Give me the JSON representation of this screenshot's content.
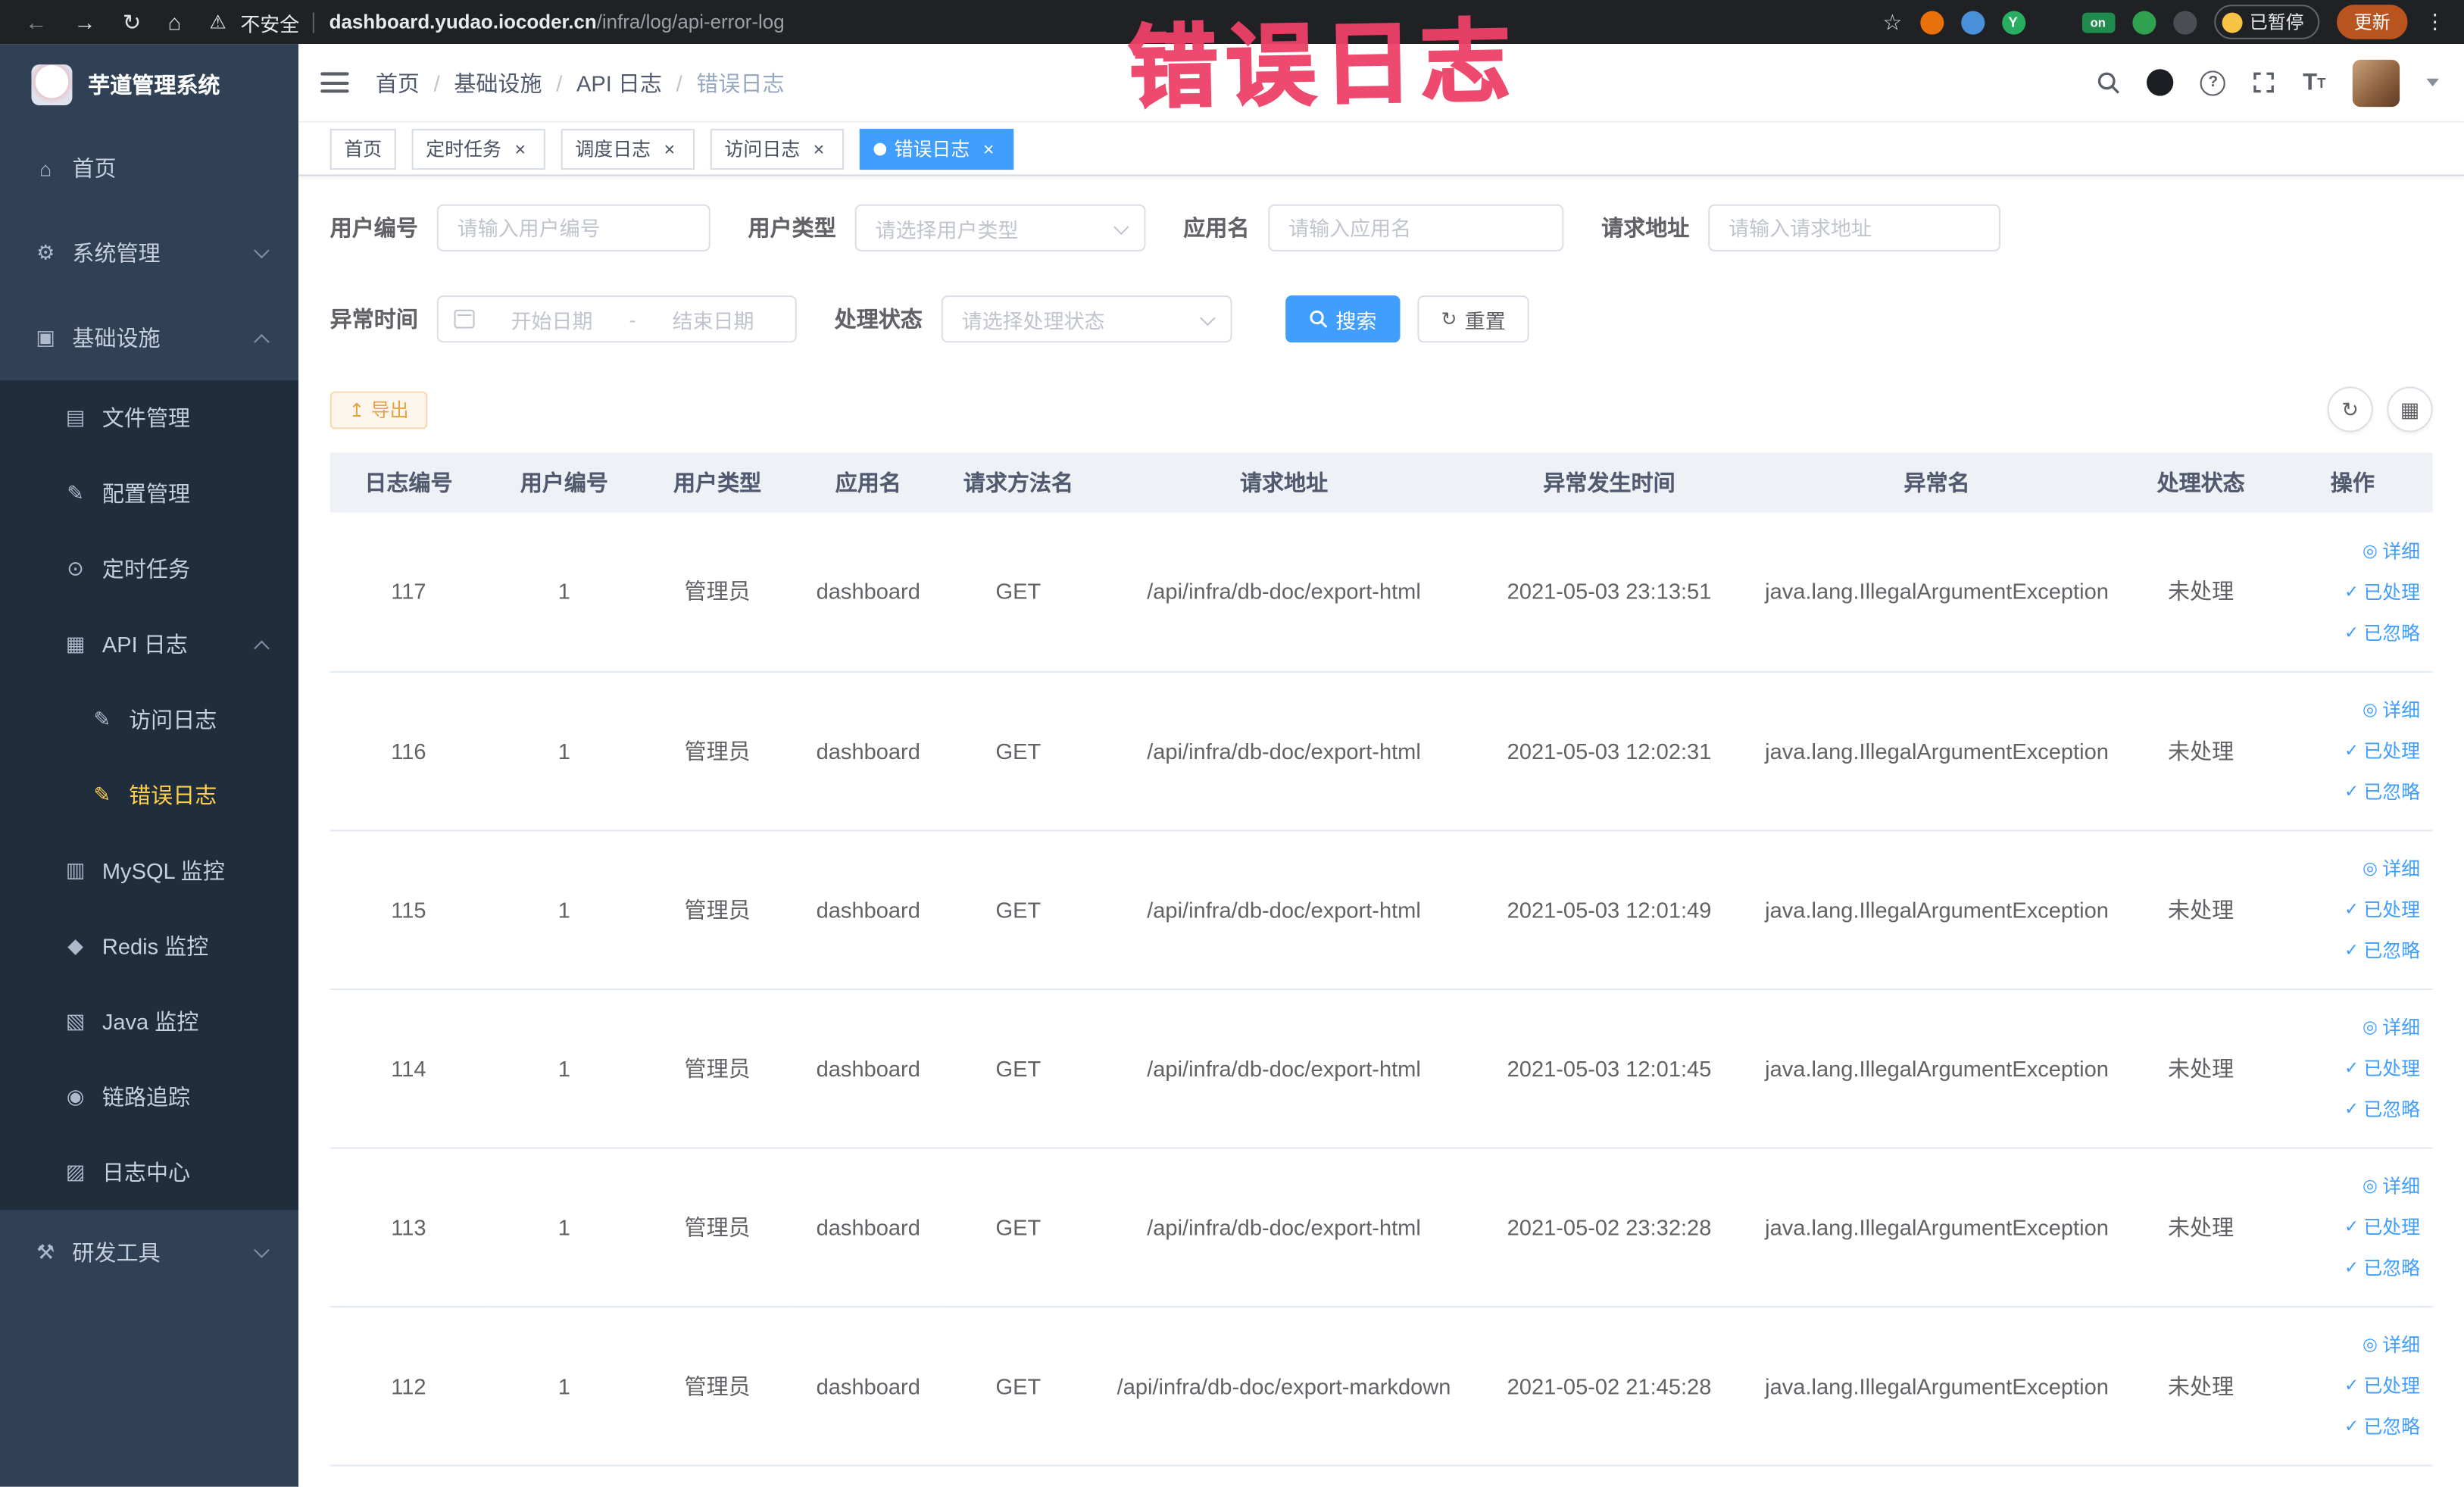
{
  "colors": {
    "accent": "#409EFF",
    "sidebar_bg": "#304156",
    "submenu_bg": "#1f2d3d",
    "active_menu_item": "#ffd04b",
    "warning": "#e6a23c",
    "annotation": "#ee4168"
  },
  "browser": {
    "security_label": "不安全",
    "url": "dashboard.yudao.iocoder.cn/infra/log/api-error-log",
    "paused_badge": "已暂停",
    "update_button": "更新"
  },
  "annotation": {
    "text": "错误日志"
  },
  "sidebar": {
    "title": "芋道管理系统",
    "items": [
      {
        "key": "home",
        "label": "首页",
        "icon": "home-icon"
      },
      {
        "key": "system",
        "label": "系统管理",
        "icon": "gear-icon",
        "group": true,
        "expanded": false
      },
      {
        "key": "infra",
        "label": "基础设施",
        "icon": "infra-icon",
        "group": true,
        "expanded": true,
        "children": [
          {
            "key": "file",
            "label": "文件管理",
            "icon": "file-icon"
          },
          {
            "key": "config",
            "label": "配置管理",
            "icon": "config-icon"
          },
          {
            "key": "job",
            "label": "定时任务",
            "icon": "timer-icon"
          },
          {
            "key": "api-log",
            "label": "API 日志",
            "icon": "api-log-icon",
            "group": true,
            "expanded": true,
            "children": [
              {
                "key": "access-log",
                "label": "访问日志",
                "icon": "access-log-icon"
              },
              {
                "key": "error-log",
                "label": "错误日志",
                "icon": "error-log-icon",
                "active": true
              }
            ]
          },
          {
            "key": "mysql",
            "label": "MySQL 监控",
            "icon": "mysql-icon"
          },
          {
            "key": "redis",
            "label": "Redis 监控",
            "icon": "redis-icon"
          },
          {
            "key": "java",
            "label": "Java 监控",
            "icon": "java-icon"
          },
          {
            "key": "trace",
            "label": "链路追踪",
            "icon": "trace-icon"
          },
          {
            "key": "log-center",
            "label": "日志中心",
            "icon": "log-center-icon"
          }
        ]
      },
      {
        "key": "devtools",
        "label": "研发工具",
        "icon": "tools-icon",
        "group": true,
        "expanded": false
      }
    ]
  },
  "navbar": {
    "breadcrumb": [
      "首页",
      "基础设施",
      "API 日志",
      "错误日志"
    ]
  },
  "tabs": [
    {
      "label": "首页",
      "closable": false,
      "active": false
    },
    {
      "label": "定时任务",
      "closable": true,
      "active": false
    },
    {
      "label": "调度日志",
      "closable": true,
      "active": false
    },
    {
      "label": "访问日志",
      "closable": true,
      "active": false
    },
    {
      "label": "错误日志",
      "closable": true,
      "active": true
    }
  ],
  "filters": {
    "user_id": {
      "label": "用户编号",
      "placeholder": "请输入用户编号"
    },
    "user_type": {
      "label": "用户类型",
      "placeholder": "请选择用户类型"
    },
    "app_name": {
      "label": "应用名",
      "placeholder": "请输入应用名"
    },
    "request_url": {
      "label": "请求地址",
      "placeholder": "请输入请求地址"
    },
    "exception_time": {
      "label": "异常时间",
      "start_placeholder": "开始日期",
      "separator": "-",
      "end_placeholder": "结束日期"
    },
    "process_status": {
      "label": "处理状态",
      "placeholder": "请选择处理状态"
    },
    "search_button": "搜索",
    "reset_button": "重置"
  },
  "toolbar": {
    "export_button": "导出"
  },
  "table": {
    "headers": [
      "日志编号",
      "用户编号",
      "用户类型",
      "应用名",
      "请求方法名",
      "请求地址",
      "异常发生时间",
      "异常名",
      "处理状态",
      "操作"
    ],
    "actions": [
      "详细",
      "已处理",
      "已忽略"
    ],
    "rows": [
      {
        "id": "117",
        "user_id": "1",
        "user_type": "管理员",
        "app": "dashboard",
        "method": "GET",
        "url": "/api/infra/db-doc/export-html",
        "time": "2021-05-03 23:13:51",
        "exception": "java.lang.IllegalArgumentException",
        "status": "未处理"
      },
      {
        "id": "116",
        "user_id": "1",
        "user_type": "管理员",
        "app": "dashboard",
        "method": "GET",
        "url": "/api/infra/db-doc/export-html",
        "time": "2021-05-03 12:02:31",
        "exception": "java.lang.IllegalArgumentException",
        "status": "未处理"
      },
      {
        "id": "115",
        "user_id": "1",
        "user_type": "管理员",
        "app": "dashboard",
        "method": "GET",
        "url": "/api/infra/db-doc/export-html",
        "time": "2021-05-03 12:01:49",
        "exception": "java.lang.IllegalArgumentException",
        "status": "未处理"
      },
      {
        "id": "114",
        "user_id": "1",
        "user_type": "管理员",
        "app": "dashboard",
        "method": "GET",
        "url": "/api/infra/db-doc/export-html",
        "time": "2021-05-03 12:01:45",
        "exception": "java.lang.IllegalArgumentException",
        "status": "未处理"
      },
      {
        "id": "113",
        "user_id": "1",
        "user_type": "管理员",
        "app": "dashboard",
        "method": "GET",
        "url": "/api/infra/db-doc/export-html",
        "time": "2021-05-02 23:32:28",
        "exception": "java.lang.IllegalArgumentException",
        "status": "未处理"
      },
      {
        "id": "112",
        "user_id": "1",
        "user_type": "管理员",
        "app": "dashboard",
        "method": "GET",
        "url": "/api/infra/db-doc/export-markdown",
        "time": "2021-05-02 21:45:28",
        "exception": "java.lang.IllegalArgumentException",
        "status": "未处理"
      }
    ]
  }
}
